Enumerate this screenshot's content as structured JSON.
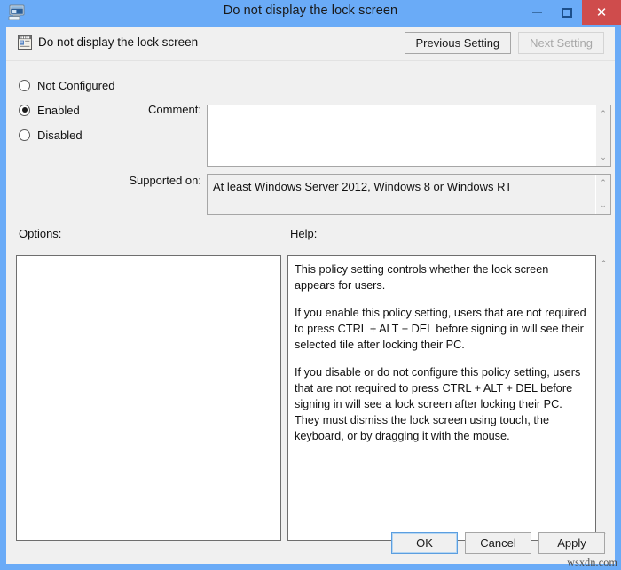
{
  "window": {
    "title": "Do not display the lock screen",
    "icon": "group-policy-monitor-icon",
    "accent_color": "#6aabf7",
    "close_color": "#cf4c4c",
    "background_color": "#f0f0f0",
    "controls": {
      "minimize": "–",
      "maximize": "□",
      "close": "✕"
    }
  },
  "header": {
    "policy_icon": "policy-setting-icon",
    "policy_name": "Do not display the lock screen",
    "previous_setting": "Previous Setting",
    "next_setting": "Next Setting",
    "next_setting_enabled": false
  },
  "state_options": [
    {
      "id": "not-configured",
      "label": "Not Configured",
      "selected": false
    },
    {
      "id": "enabled",
      "label": "Enabled",
      "selected": true
    },
    {
      "id": "disabled",
      "label": "Disabled",
      "selected": false
    }
  ],
  "fields": {
    "comment_label": "Comment:",
    "comment_value": "",
    "supported_label": "Supported on:",
    "supported_value": "At least Windows Server 2012, Windows 8 or Windows RT"
  },
  "panels": {
    "options_label": "Options:",
    "options_items": [],
    "help_label": "Help:",
    "help_paragraphs": [
      "This policy setting controls whether the lock screen appears for users.",
      "If you enable this policy setting, users that are not required to press CTRL + ALT + DEL before signing in will see their selected tile after  locking their PC.",
      "If you disable or do not configure this policy setting, users that are not required to press CTRL + ALT + DEL before signing in will see a lock screen after locking their PC. They must dismiss the lock screen using touch, the keyboard, or by dragging it with the mouse."
    ]
  },
  "footer": {
    "ok": "OK",
    "cancel": "Cancel",
    "apply": "Apply",
    "focused_button": "OK"
  },
  "scrollbar": {
    "up_arrow": "⌃",
    "down_arrow": "⌄"
  },
  "watermark": "wsxdn.com"
}
